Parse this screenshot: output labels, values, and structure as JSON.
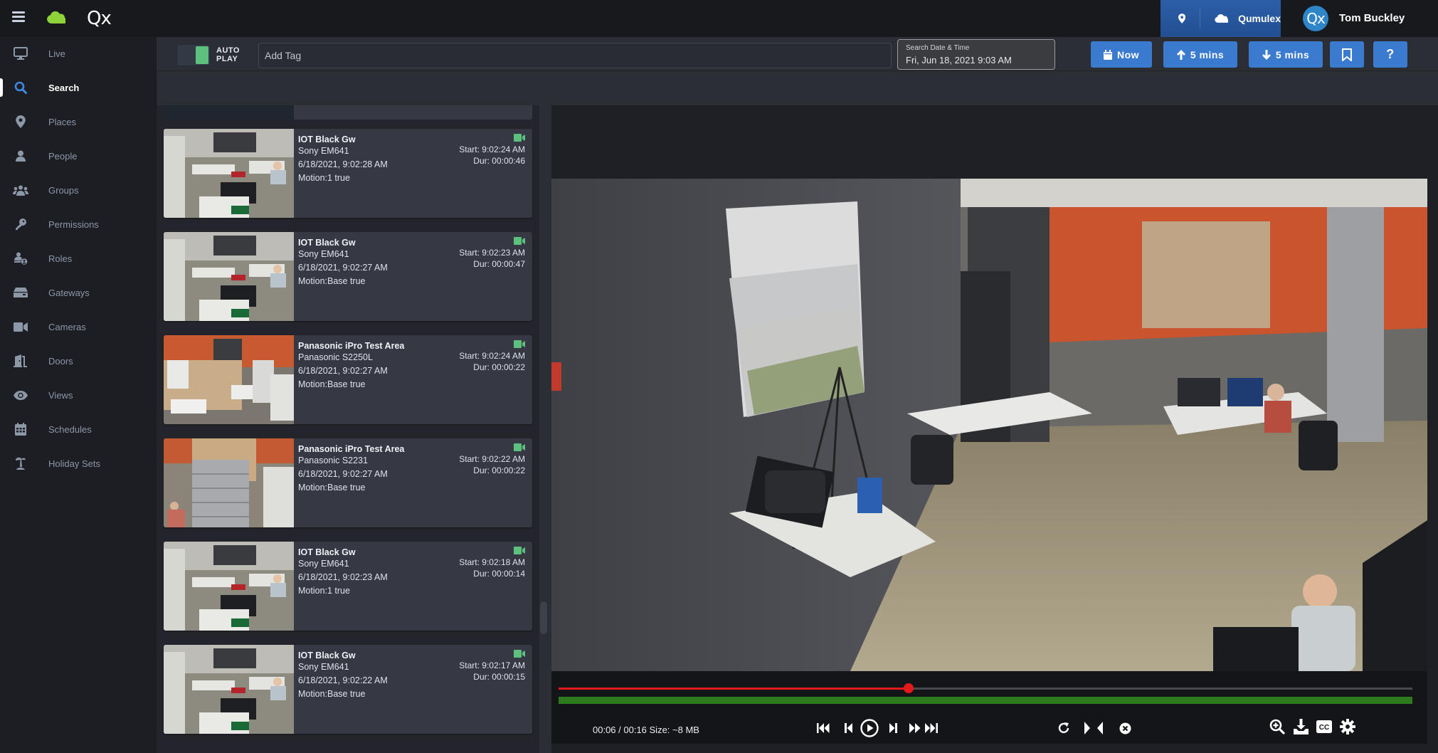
{
  "header": {
    "logo_text": "Qx",
    "org_name": "Qumulex",
    "user_initials": "Qx",
    "user_name": "Tom Buckley",
    "icons": [
      "menu-icon",
      "cloud-logo-icon",
      "map-pin-icon",
      "cloud-icon"
    ]
  },
  "sidebar": {
    "active": "Search",
    "items": [
      {
        "label": "Live",
        "icon": "monitor-icon"
      },
      {
        "label": "Search",
        "icon": "search-icon"
      },
      {
        "label": "Places",
        "icon": "map-pin-icon"
      },
      {
        "label": "People",
        "icon": "person-icon"
      },
      {
        "label": "Groups",
        "icon": "users-icon"
      },
      {
        "label": "Permissions",
        "icon": "key-icon"
      },
      {
        "label": "Roles",
        "icon": "user-role-icon"
      },
      {
        "label": "Gateways",
        "icon": "gateway-icon"
      },
      {
        "label": "Cameras",
        "icon": "video-camera-icon"
      },
      {
        "label": "Doors",
        "icon": "door-icon"
      },
      {
        "label": "Views",
        "icon": "eye-icon"
      },
      {
        "label": "Schedules",
        "icon": "calendar-icon"
      },
      {
        "label": "Holiday Sets",
        "icon": "palm-tree-icon"
      }
    ]
  },
  "toolbar": {
    "autoplay_label_1": "AUTO",
    "autoplay_label_2": "PLAY",
    "autoplay_on": true,
    "tag_placeholder": "Add Tag",
    "tag_value": "",
    "date_label": "Search Date & Time",
    "date_value": "Fri, Jun 18, 2021 9:03 AM",
    "now_label": "Now",
    "back_label": "5 mins",
    "forward_label": "5 mins",
    "bookmark_icon": "bookmark-icon",
    "help_label": "?"
  },
  "events": [
    {
      "camera": "IOT Black Gw",
      "model": "Sony EM641",
      "timestamp": "6/18/2021, 9:02:28 AM",
      "trigger": "Motion:1 true",
      "start": "Start: 9:02:24 AM",
      "duration": "Dur: 00:00:46",
      "thumb": "warehouse"
    },
    {
      "camera": "IOT Black Gw",
      "model": "Sony EM641",
      "timestamp": "6/18/2021, 9:02:27 AM",
      "trigger": "Motion:Base true",
      "start": "Start: 9:02:23 AM",
      "duration": "Dur: 00:00:47",
      "thumb": "warehouse"
    },
    {
      "camera": "Panasonic iPro Test Area",
      "model": "Panasonic S2250L",
      "timestamp": "6/18/2021, 9:02:27 AM",
      "trigger": "Motion:Base true",
      "start": "Start: 9:02:24 AM",
      "duration": "Dur: 00:00:22",
      "thumb": "orange"
    },
    {
      "camera": "Panasonic iPro Test Area",
      "model": "Panasonic S2231",
      "timestamp": "6/18/2021, 9:02:27 AM",
      "trigger": "Motion:Base true",
      "start": "Start: 9:02:22 AM",
      "duration": "Dur: 00:00:22",
      "thumb": "racks"
    },
    {
      "camera": "IOT Black Gw",
      "model": "Sony EM641",
      "timestamp": "6/18/2021, 9:02:23 AM",
      "trigger": "Motion:1 true",
      "start": "Start: 9:02:18 AM",
      "duration": "Dur: 00:00:14",
      "thumb": "warehouse"
    },
    {
      "camera": "IOT Black Gw",
      "model": "Sony EM641",
      "timestamp": "6/18/2021, 9:02:22 AM",
      "trigger": "Motion:Base true",
      "start": "Start: 9:02:17 AM",
      "duration": "Dur: 00:00:15",
      "thumb": "warehouse"
    }
  ],
  "player": {
    "elapsed": "00:06",
    "total": "00:16",
    "time_text": "00:06 / 00:16  Size: ~8 MB",
    "size": "~8 MB",
    "progress_fraction": 0.41,
    "buffered_fraction": 1.0,
    "colors": {
      "progress": "#e3191c",
      "buffer": "#2e7a1e"
    }
  }
}
